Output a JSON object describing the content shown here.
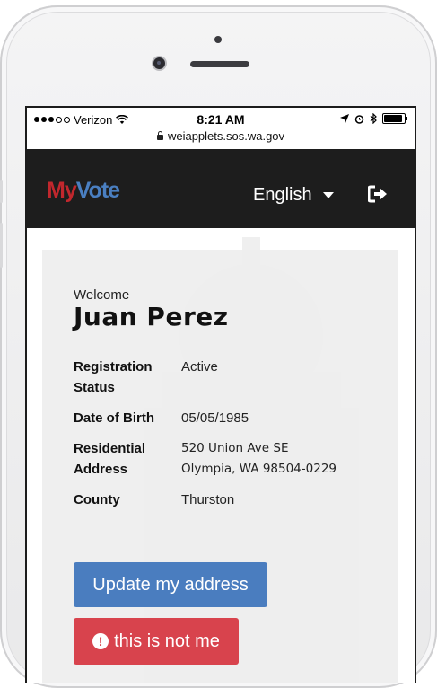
{
  "status_bar": {
    "carrier": "Verizon",
    "time": "8:21 AM"
  },
  "browser": {
    "url": "weiapplets.sos.wa.gov"
  },
  "header": {
    "logo_my": "My",
    "logo_vote": "Vote",
    "language": "English"
  },
  "profile": {
    "welcome": "Welcome",
    "name": "Juan Perez",
    "fields": [
      {
        "label_line1": "Registration",
        "label_line2": "Status",
        "value": "Active"
      },
      {
        "label": "Date of Birth",
        "value": "05/05/1985"
      },
      {
        "label_line1": "Residential",
        "label_line2": "Address",
        "value_line1": "520 Union Ave SE",
        "value_line2": "Olympia, WA 98504-0229"
      },
      {
        "label": "County",
        "value": "Thurston"
      }
    ]
  },
  "actions": {
    "update_address": "Update my address",
    "not_me": "this is not me"
  },
  "colors": {
    "header_bg": "#1d1d1d",
    "logo_red": "#c1272d",
    "logo_blue": "#4a7fc1",
    "primary_button": "#4a7dbf",
    "danger_button": "#d8434d"
  }
}
